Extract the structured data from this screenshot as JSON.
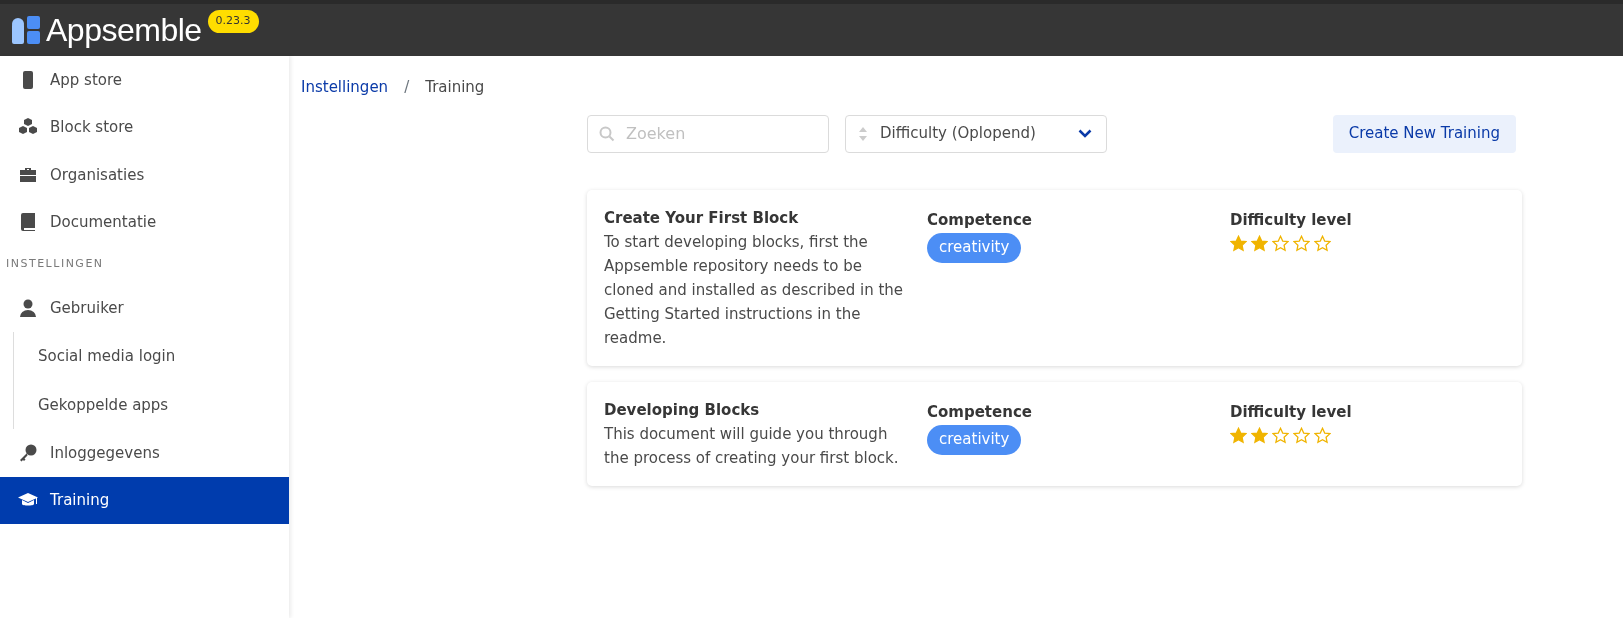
{
  "navbar": {
    "brand": "Appsemble",
    "version": "0.23.3"
  },
  "sidebar": {
    "items": [
      {
        "kind": "item",
        "label": "App store",
        "selected": false
      },
      {
        "kind": "item",
        "label": "Block store",
        "selected": false
      },
      {
        "kind": "item",
        "label": "Organisaties",
        "selected": false
      },
      {
        "kind": "item",
        "label": "Documentatie",
        "selected": false
      },
      {
        "kind": "section",
        "label": "INSTELLINGEN"
      },
      {
        "kind": "item",
        "label": "Gebruiker",
        "selected": false,
        "children": [
          {
            "label": "Social media login",
            "selected": false
          },
          {
            "label": "Gekoppelde apps",
            "selected": false
          }
        ]
      },
      {
        "kind": "item",
        "label": "Inloggegevens",
        "selected": false
      },
      {
        "kind": "item",
        "label": "Training",
        "selected": true
      }
    ]
  },
  "breadcrumb": [
    "Instellingen",
    "Training"
  ],
  "breadcrumb_separator": "/",
  "search": {
    "placeholder": "Zoeken"
  },
  "sort": {
    "value": "Difficulty (Oplopend)"
  },
  "create_button": "Create New Training",
  "trainings": [
    {
      "title": "Create Your First Block",
      "description": "To start developing blocks, first the Appsemble repository needs to be cloned and installed as described in the Getting Started instructions in the readme.",
      "competence_label": "Competence",
      "competence": "creativity",
      "difficulty_label": "Difficulty level",
      "stars": 2
    },
    {
      "title": "Developing Blocks",
      "description": "This document will guide you through the process of creating your first block.",
      "competence_label": "Competence",
      "competence": "creativity",
      "difficulty_label": "Difficulty level",
      "stars": 2
    }
  ]
}
